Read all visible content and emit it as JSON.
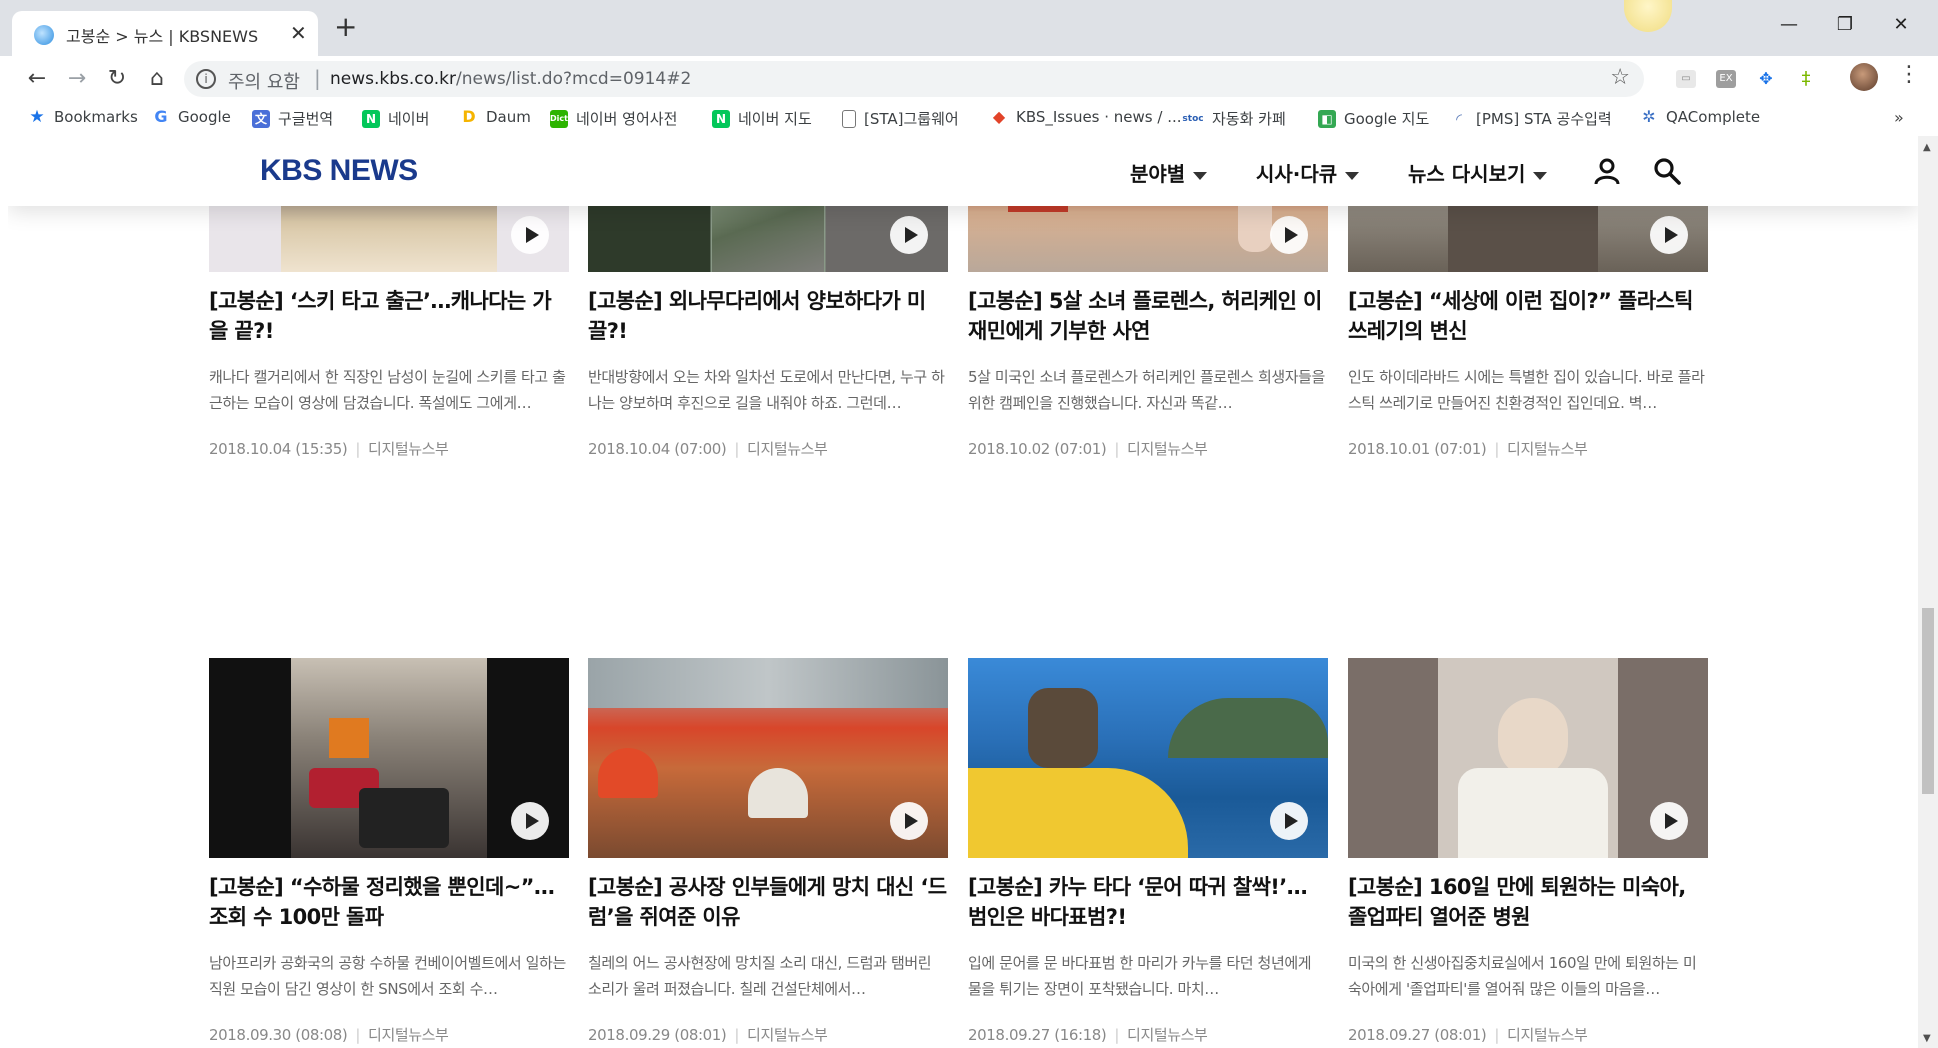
{
  "browser": {
    "tab_title": "고봉순 > 뉴스 | KBSNEWS",
    "tab_close": "✕",
    "new_tab": "+",
    "window_controls": {
      "minimize": "—",
      "restore": "❐",
      "close": "✕"
    },
    "security_label": "주의 요함",
    "url_host": "news.kbs.co.kr",
    "url_path": "/news/list.do?mcd=0914#2",
    "icons": [
      "back-icon",
      "forward-icon",
      "reload-icon",
      "home-icon",
      "info-icon",
      "star-icon",
      "profile-avatar",
      "menu-icon"
    ]
  },
  "bookmarks": [
    {
      "label": "Bookmarks",
      "icon": "star",
      "color": "#1a73e8"
    },
    {
      "label": "Google",
      "icon": "G",
      "color": "#4285f4"
    },
    {
      "label": "구글번역",
      "icon": "translate",
      "color": "#4a6fd8"
    },
    {
      "label": "네이버",
      "icon": "N",
      "color": "#03c75a"
    },
    {
      "label": "Daum",
      "icon": "D",
      "color": "#f5b400"
    },
    {
      "label": "네이버 영어사전",
      "icon": "Dict",
      "color": "#2db400"
    },
    {
      "label": "네이버 지도",
      "icon": "N",
      "color": "#03c75a"
    },
    {
      "label": "[STA]그룹웨어",
      "icon": "page",
      "color": "#777777"
    },
    {
      "label": "KBS_Issues · news / ...",
      "icon": "gitlab",
      "color": "#e24329"
    },
    {
      "label": "자동화 카페",
      "icon": "stoc",
      "color": "#2b5fb4"
    },
    {
      "label": "Google 지도",
      "icon": "map",
      "color": "#34a853"
    },
    {
      "label": "[PMS] STA 공수입력",
      "icon": "pms",
      "color": "#5b7bb8"
    },
    {
      "label": "QAComplete",
      "icon": "qa",
      "color": "#3a6fc4"
    }
  ],
  "bookmarks_more": "»",
  "site": {
    "logo": "KBS NEWS",
    "nav": [
      "분야별",
      "시사·다큐",
      "뉴스 다시보기"
    ]
  },
  "cards": [
    {
      "title": "[고봉순] ‘스키 타고 출근’…캐나다는 가을 끝?!",
      "desc": "캐나다 캘거리에서 한 직장인 남성이 눈길에 스키를 타고 출근하는 모습이 영상에 담겼습니다. 폭설에도 그에게…",
      "date": "2018.10.04 (15:35)",
      "dept": "디지털뉴스부"
    },
    {
      "title": "[고봉순] 외나무다리에서 양보하다가 미끌?!",
      "desc": "반대방향에서 오는 차와 일차선 도로에서 만난다면, 누구 하나는 양보하며 후진으로 길을 내줘야 하죠. 그런데…",
      "date": "2018.10.04 (07:00)",
      "dept": "디지털뉴스부"
    },
    {
      "title": "[고봉순] 5살 소녀 플로렌스, 허리케인 이재민에게 기부한 사연",
      "desc": "5살 미국인 소녀 플로렌스가 허리케인 플로렌스 희생자들을 위한 캠페인을 진행했습니다. 자신과 똑같…",
      "date": "2018.10.02 (07:01)",
      "dept": "디지털뉴스부"
    },
    {
      "title": "[고봉순] “세상에 이런 집이?” 플라스틱 쓰레기의 변신",
      "desc": "인도 하이데라바드 시에는 특별한 집이 있습니다. 바로 플라스틱 쓰레기로 만들어진 친환경적인 집인데요. 벽…",
      "date": "2018.10.01 (07:01)",
      "dept": "디지털뉴스부"
    },
    {
      "title": "[고봉순] “수하물 정리했을 뿐인데~”… 조회 수 100만 돌파",
      "desc": "남아프리카 공화국의 공항 수하물 컨베이어벨트에서 일하는 직원 모습이 담긴 영상이 한 SNS에서 조회 수…",
      "date": "2018.09.30 (08:08)",
      "dept": "디지털뉴스부"
    },
    {
      "title": "[고봉순] 공사장 인부들에게 망치 대신 ‘드럼’을 쥐여준 이유",
      "desc": "칠레의 어느 공사현장에 망치질 소리 대신, 드럼과 탬버린 소리가 울려 퍼졌습니다. 칠레 건설단체에서…",
      "date": "2018.09.29 (08:01)",
      "dept": "디지털뉴스부"
    },
    {
      "title": "[고봉순] 카누 타다 ‘문어 따귀 찰싹!’… 범인은 바다표범?!",
      "desc": "입에 문어를 문 바다표범 한 마리가 카누를 타던 청년에게 물을 튀기는 장면이 포착됐습니다. 마치…",
      "date": "2018.09.27 (16:18)",
      "dept": "디지털뉴스부"
    },
    {
      "title": "[고봉순] 160일 만에 퇴원하는 미숙아, 졸업파티 열어준 병원",
      "desc": "미국의 한 신생아집중치료실에서 160일 만에 퇴원하는 미숙아에게 '졸업파티'를 열어줘 많은 이들의 마음을…",
      "date": "2018.09.27 (08:01)",
      "dept": "디지털뉴스부"
    }
  ]
}
